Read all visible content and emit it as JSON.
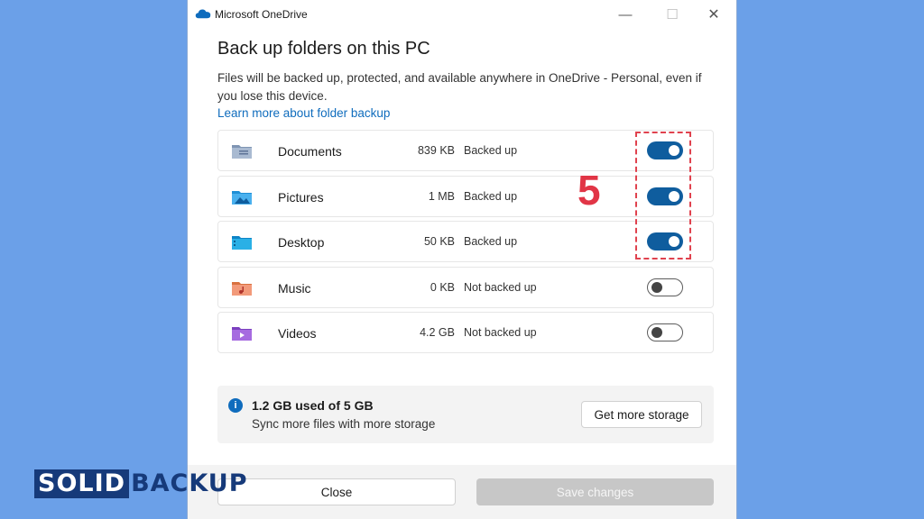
{
  "window": {
    "title": "Microsoft OneDrive",
    "minimize_glyph": "—",
    "maximize_glyph": "☐",
    "close_glyph": "✕"
  },
  "heading": "Back up folders on this PC",
  "description": "Files will be backed up, protected, and available anywhere in OneDrive - Personal, even if you lose this device.",
  "learn_more_link": "Learn more about folder backup",
  "folders": [
    {
      "name": "Documents",
      "size": "839 KB",
      "status": "Backed up",
      "enabled": true,
      "icon": "documents-folder-icon"
    },
    {
      "name": "Pictures",
      "size": "1 MB",
      "status": "Backed up",
      "enabled": true,
      "icon": "pictures-folder-icon"
    },
    {
      "name": "Desktop",
      "size": "50 KB",
      "status": "Backed up",
      "enabled": true,
      "icon": "desktop-folder-icon"
    },
    {
      "name": "Music",
      "size": "0 KB",
      "status": "Not backed up",
      "enabled": false,
      "icon": "music-folder-icon"
    },
    {
      "name": "Videos",
      "size": "4.2 GB",
      "status": "Not backed up",
      "enabled": false,
      "icon": "videos-folder-icon"
    }
  ],
  "annotation": {
    "step_number": "5",
    "color": "#e13546"
  },
  "storage": {
    "used_text": "1.2 GB used of 5 GB",
    "subtext": "Sync more files with more storage",
    "info_glyph": "i",
    "get_more_label": "Get more storage"
  },
  "footer": {
    "close_label": "Close",
    "save_label": "Save changes"
  },
  "branding": {
    "part1": "SOLID",
    "part2": "BACKUP"
  },
  "colors": {
    "accent": "#0f5d9e",
    "link": "#0f6cbd",
    "background": "#6ba0e8"
  }
}
